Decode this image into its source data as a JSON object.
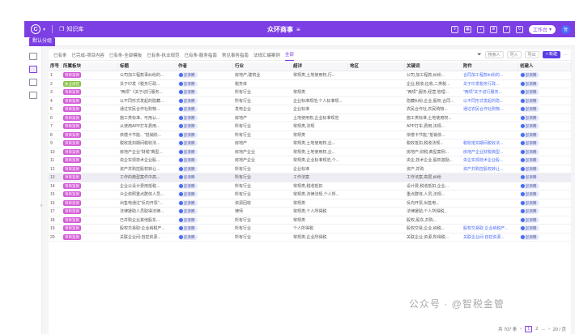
{
  "header": {
    "app_title": "知识库",
    "center_title": "众环商事",
    "user_pill": "工作台",
    "avatar_text": "管",
    "logo_text": "C"
  },
  "tab": {
    "label": "默认分组"
  },
  "views": [
    "已有条",
    "已完成-项目内容",
    "已有条-全部模板",
    "已有条-执业规范",
    "已有条-服务指南",
    "常见事务指南",
    "法规汇编案例",
    "全部"
  ],
  "toolbar": {
    "search_placeholder": "搜索人",
    "import": "导入",
    "export": "导出",
    "add": "+ 新建"
  },
  "columns": [
    "序号",
    "所属板块",
    "标题",
    "作者",
    "行业",
    "超详",
    "地区",
    "关键词",
    "附件",
    "创建人"
  ],
  "rows": [
    {
      "n": "1",
      "tag": "项目案例",
      "tagc": "pink",
      "title": "公司加工程款事纠纷的...",
      "author": "彭湃腾",
      "ind": "房地产,建筑业",
      "detail": "常规类,土地使用权,行...",
      "kw": "公司,加工程款,纠纷...",
      "att": "合同加工程款纠纷的...",
      "creator": "彭湃腾"
    },
    {
      "n": "2",
      "tag": "执业规范",
      "tagc": "green",
      "title": "关于印发《税务行政...",
      "author": "彭湃腾",
      "ind": "税务体",
      "detail": "",
      "kw": "企业,税收,征收,二类税...",
      "att": "关于印发税务行政...",
      "creator": "彭湃腾"
    },
    {
      "n": "3",
      "tag": "项目案例",
      "tagc": "pink",
      "title": "\"两项\"《关于进行服务...",
      "author": "彭湃腾",
      "ind": "所有行业",
      "detail": "常规类",
      "kw": "\"两项\",服务,经营,管理...",
      "att": "\"两项\"关于进行服务...",
      "creator": "彭湃腾"
    },
    {
      "n": "4",
      "tag": "项目案例",
      "tagc": "pink",
      "title": "以不同形式发起的隐藏...",
      "author": "彭湃腾",
      "ind": "所有行业",
      "detail": "企业标准规范,个人标准规...",
      "kw": "隐藏纠纷,企业,股权,合同...",
      "att": "以不同形式发起的隐...",
      "creator": "彭湃腾"
    },
    {
      "n": "5",
      "tag": "项目案例",
      "tagc": "pink",
      "title": "通过农民合作社购物...",
      "author": "彭湃腾",
      "ind": "发电企业",
      "detail": "企业标准",
      "kw": "农民合作社,农民购物...",
      "att": "通过农民合作社购物...",
      "creator": "彭湃腾"
    },
    {
      "n": "6",
      "tag": "项目案例",
      "tagc": "pink",
      "title": "施工类标准、可用认...",
      "author": "彭湃腾",
      "ind": "房地产",
      "detail": "土地使用权,企业标准规范",
      "kw": "施工类标准,土地使用权...",
      "att": "",
      "creator": "彭湃腾"
    },
    {
      "n": "7",
      "tag": "项目案例",
      "tagc": "pink",
      "title": "从使用APP打车费用...",
      "author": "彭湃腾",
      "ind": "所有行业",
      "detail": "常规类,法规",
      "kw": "APP打车,费用,法规...",
      "att": "",
      "creator": "彭湃腾"
    },
    {
      "n": "8",
      "tag": "项目案例",
      "tagc": "pink",
      "title": "依偿卡节能、\"抵销债...",
      "author": "彭湃腾",
      "ind": "所有行业",
      "detail": "常规类",
      "kw": "依偿卡节能,\"抵销债...",
      "att": "",
      "creator": "彭湃腾"
    },
    {
      "n": "9",
      "tag": "项目案例",
      "tagc": "pink",
      "title": "税收抵扣期间税收法...",
      "author": "彭湃腾",
      "ind": "房地产",
      "detail": "常规类,土地使用权,企...",
      "kw": "税收抵扣,税收法规...",
      "att": "税收抵扣期间税收法...",
      "creator": "彭湃腾"
    },
    {
      "n": "10",
      "tag": "项目案例",
      "tagc": "pink",
      "title": "房地产企业\"财税\"典型...",
      "author": "彭湃腾",
      "ind": "房地产企业",
      "detail": "常规类,土地使用权,企...",
      "kw": "房地产,财税,典型案例...",
      "att": "房地产企业财税典型...",
      "creator": "彭湃腾"
    },
    {
      "n": "11",
      "tag": "项目案例",
      "tagc": "pink",
      "title": "央企实现技术企业股...",
      "author": "彭湃腾",
      "ind": "房地产企业",
      "detail": "常规类,企业标准规范,个...",
      "kw": "央企,技术企业,股权激励...",
      "att": "央企实现技术企业股...",
      "creator": "彭湃腾"
    },
    {
      "n": "12",
      "tag": "项目案例",
      "tagc": "pink",
      "title": "资产并购控股权转让...",
      "author": "彭湃腾",
      "ind": "所有行业",
      "detail": "企业标准",
      "kw": "资产,并购",
      "att": "资产并购控股权转让...",
      "creator": "彭湃腾"
    },
    {
      "n": "13",
      "tag": "项目案例",
      "tagc": "pink",
      "title": "工作的典型案件中高...",
      "author": "彭湃腾",
      "ind": "所有行业",
      "detail": "工作法案",
      "kw": "工作法案,高层,纠纷",
      "att": "",
      "creator": "彭湃腾"
    },
    {
      "n": "14",
      "tag": "项目案例",
      "tagc": "pink",
      "title": "企业以设计费用抵税...",
      "author": "彭湃腾",
      "ind": "所有行业",
      "detail": "常规类,税收抵扣",
      "kw": "设计费,税收抵扣,企业...",
      "att": "",
      "creator": "彭湃腾"
    },
    {
      "n": "15",
      "tag": "项目案例",
      "tagc": "pink",
      "title": "众企依照重点群体人员...",
      "author": "彭湃腾",
      "ind": "所有行业",
      "detail": "常规类,法律法规,个人所...",
      "kw": "重点群体,人员,法规...",
      "att": "",
      "creator": "彭湃腾"
    },
    {
      "n": "16",
      "tag": "项目案例",
      "tagc": "pink",
      "title": "出售电通过\"反向开票\"...",
      "author": "彭湃腾",
      "ind": "资源回收",
      "detail": "常规类",
      "kw": "反向开票,出售电...",
      "att": "",
      "creator": "彭湃腾"
    },
    {
      "n": "17",
      "tag": "项目案例",
      "tagc": "pink",
      "title": "法律援助人员取得法律...",
      "author": "彭湃腾",
      "ind": "律师",
      "detail": "常规类,个人所得税",
      "kw": "法律援助,个人所得税...",
      "att": "",
      "creator": "彭湃腾"
    },
    {
      "n": "18",
      "tag": "项目案例",
      "tagc": "pink",
      "title": "已并购企业其他股东...",
      "author": "彭湃腾",
      "ind": "所有行业",
      "detail": "常规类",
      "kw": "股权,股东,并购...",
      "att": "",
      "creator": "彭湃腾"
    },
    {
      "n": "19",
      "tag": "项目案例",
      "tagc": "pink",
      "title": "股权交易取:企业纳税产...",
      "author": "彭湃腾",
      "ind": "所有行业",
      "detail": "个人所得税",
      "kw": "股权交易,企业,纳税...",
      "att": "股权交易取 企业纳税产...",
      "creator": "彭湃腾"
    },
    {
      "n": "20",
      "tag": "项目案例",
      "tagc": "pink",
      "title": "关联企业间:自控资源...",
      "author": "彭湃腾",
      "ind": "所有行业",
      "detail": "常规类,企业所得税",
      "kw": "关联企业,资源,所得税...",
      "att": "关联企业间 自控资源...",
      "creator": "彭湃腾"
    }
  ],
  "footer": {
    "total": "共 707 条",
    "page": "1",
    "next": "2",
    "last": "...",
    "page_size": "20 / 页"
  },
  "watermark": "公众号 · @智税金管"
}
